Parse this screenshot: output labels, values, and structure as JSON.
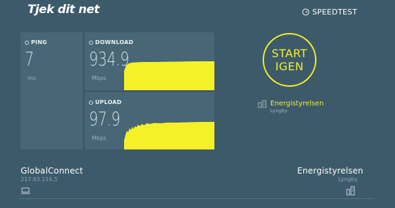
{
  "header": {
    "logo_main": "Tjek dit ",
    "logo_accent": "net",
    "speedtest_label": "SPEEDTEST",
    "speedtest_icon": "gauge-icon"
  },
  "metrics": {
    "ping": {
      "label": "PING",
      "value": "7",
      "unit": "ms"
    },
    "download": {
      "label": "DOWNLOAD",
      "value": "934.9",
      "unit": "Mbps"
    },
    "upload": {
      "label": "UPLOAD",
      "value": "97.9",
      "unit": "Mbps"
    }
  },
  "start_button": {
    "line1": "START",
    "line2": "IGEN"
  },
  "server": {
    "name": "Energistyrelsen",
    "city": "Lyngby"
  },
  "footer": {
    "isp_name": "GlobalConnect",
    "isp_ip": "217.63.116.5",
    "server_name": "Energistyrelsen",
    "server_city": "Lyngby"
  },
  "colors": {
    "background": "#3d5a6b",
    "card": "#486675",
    "accent": "#f5f029"
  }
}
